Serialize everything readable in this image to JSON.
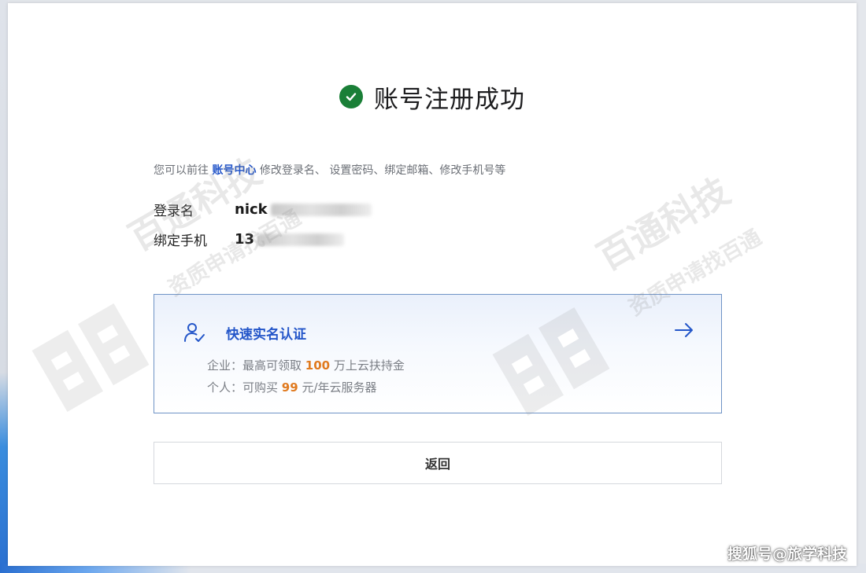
{
  "success": {
    "title": "账号注册成功"
  },
  "hint": {
    "prefix": "您可以前往",
    "link": "账号中心",
    "suffix": "修改登录名、 设置密码、绑定邮箱、修改手机号等"
  },
  "account": {
    "login_label": "登录名",
    "login_value": "nick",
    "phone_label": "绑定手机",
    "phone_value": "13"
  },
  "verify": {
    "title": "快速实名认证",
    "enterprise_prefix": "企业：最高可领取",
    "enterprise_amount": "100",
    "enterprise_suffix": "万上云扶持金",
    "personal_prefix": "个人：可购买",
    "personal_amount": "99",
    "personal_suffix": "元/年云服务器"
  },
  "actions": {
    "back_label": "返回"
  },
  "watermark": {
    "brand": "百通科技",
    "slogan": "资质申请找百通"
  },
  "footer": {
    "credit": "搜狐号@旅学科技"
  },
  "colors": {
    "success": "#1a7f37",
    "link": "#2456c9",
    "highlight": "#e07a1f",
    "card_border": "#6f93c6"
  },
  "icons": {
    "success": "check-circle-icon",
    "verify": "user-check-icon",
    "arrow": "arrow-right-icon"
  }
}
